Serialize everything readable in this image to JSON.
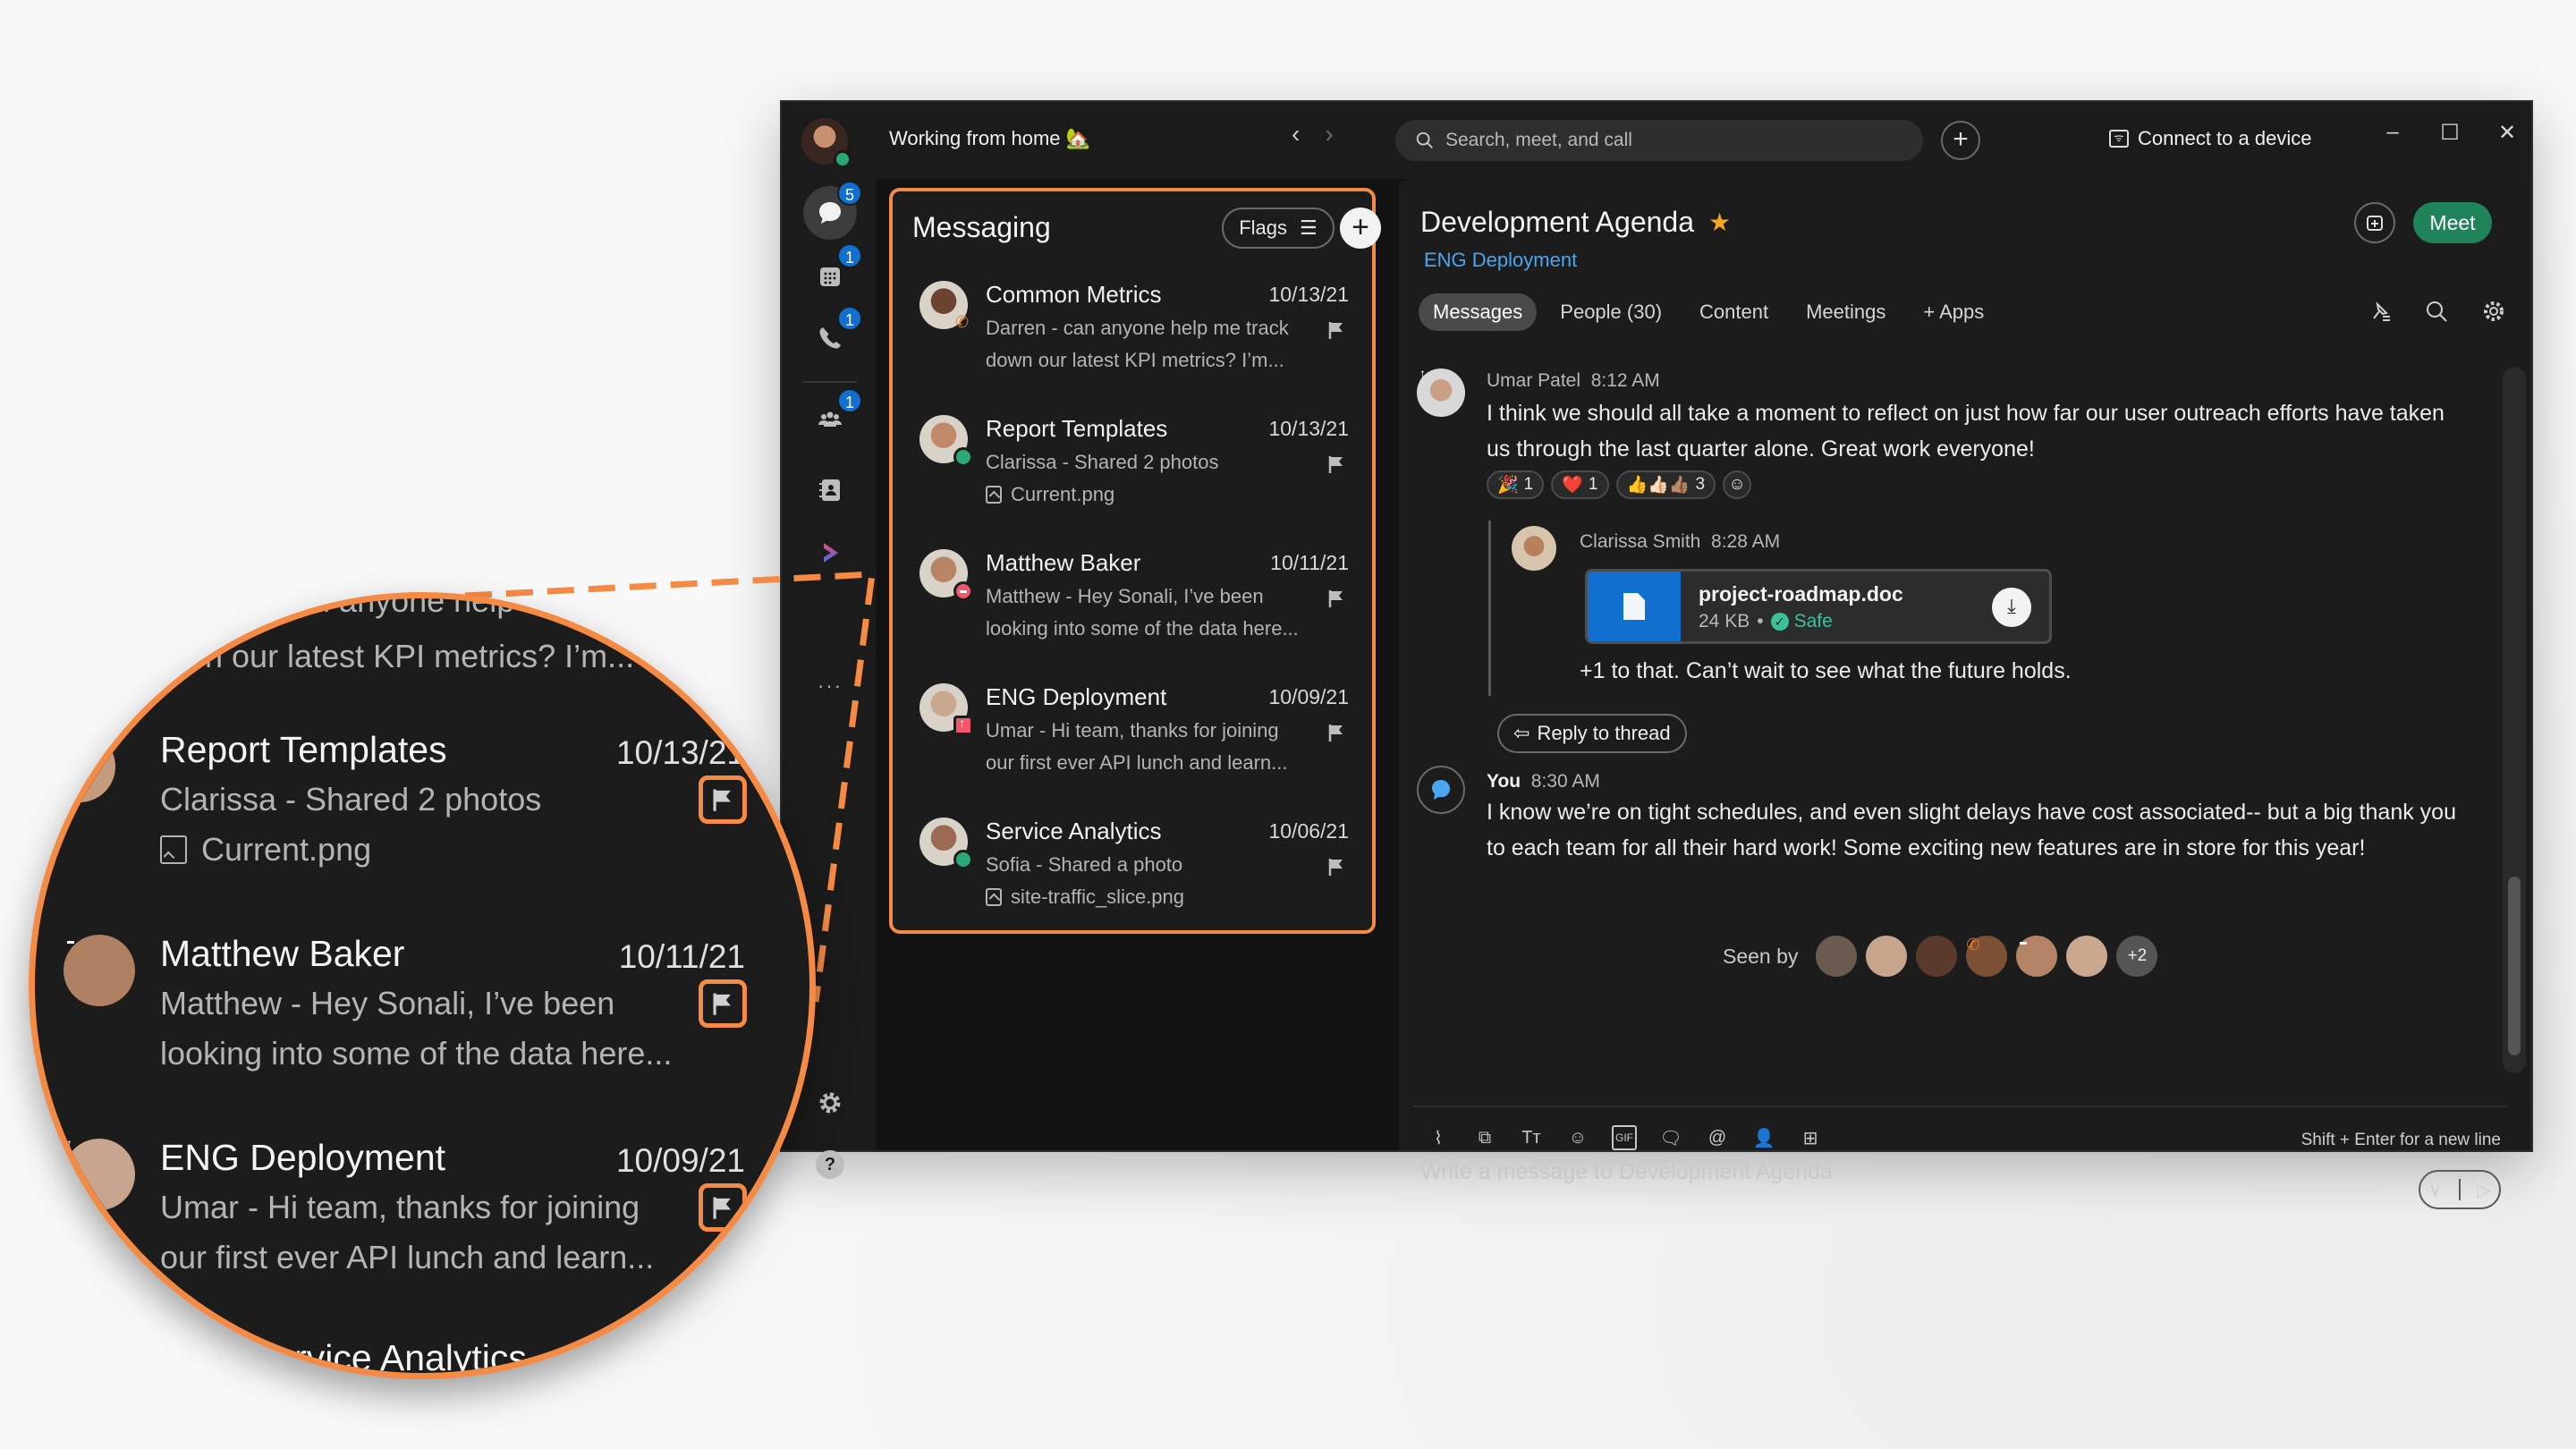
{
  "titlebar": {
    "status_text": "Working from home 🏡",
    "search_placeholder": "Search, meet, and call",
    "connect_label": "Connect to a device",
    "nav_back": "‹",
    "nav_forward": "›",
    "new_label": "+",
    "window_controls": {
      "minimize": "–",
      "maximize": "☐",
      "close": "✕"
    }
  },
  "rail": {
    "items": [
      {
        "name": "messaging",
        "badge": "5",
        "active": true
      },
      {
        "name": "calendar",
        "badge": "1"
      },
      {
        "name": "calling",
        "badge": "1"
      },
      {
        "name": "teams",
        "badge": "1"
      },
      {
        "name": "contacts",
        "badge": ""
      },
      {
        "name": "webex-app",
        "badge": ""
      }
    ],
    "more_label": "···",
    "help_label": "?"
  },
  "list": {
    "title": "Messaging",
    "filter_label": "Flags",
    "add_label": "+",
    "conversations": [
      {
        "name": "Common Metrics",
        "date": "10/13/21",
        "preview1": "Darren - can anyone help me track",
        "preview2": "down our latest KPI metrics? I’m...",
        "attachment": false,
        "status": "call",
        "flagged": true
      },
      {
        "name": "Report Templates",
        "date": "10/13/21",
        "preview1": "Clarissa - Shared 2 photos",
        "preview2": "Current.png",
        "attachment": true,
        "status": "available",
        "flagged": true
      },
      {
        "name": "Matthew Baker",
        "date": "10/11/21",
        "preview1": "Matthew - Hey Sonali, I’ve been",
        "preview2": "looking into some of the data here...",
        "attachment": false,
        "status": "dnd",
        "flagged": true
      },
      {
        "name": "ENG Deployment",
        "date": "10/09/21",
        "preview1": "Umar - Hi team, thanks for joining",
        "preview2": "our first ever API lunch and learn...",
        "attachment": false,
        "status": "out-of-office",
        "flagged": true
      },
      {
        "name": "Service Analytics",
        "date": "10/06/21",
        "preview1": "Sofia - Shared a photo",
        "preview2": "site-traffic_slice.png",
        "attachment": true,
        "status": "available",
        "flagged": true
      }
    ]
  },
  "space": {
    "title": "Development Agenda",
    "team": "ENG Deployment",
    "meet_label": "Meet",
    "tabs": [
      "Messages",
      "People (30)",
      "Content",
      "Meetings",
      "+  Apps"
    ],
    "active_tab": "Messages"
  },
  "messages": [
    {
      "author": "Umar Patel",
      "time": "8:12 AM",
      "text": "I think we should all take a moment to reflect on just how far our user outreach efforts have taken us through the last quarter alone. Great work everyone!",
      "reactions": [
        {
          "emoji": "🎉",
          "count": "1"
        },
        {
          "emoji": "❤️",
          "count": "1"
        },
        {
          "emoji": "👍👍🏻👍🏽",
          "count": "3"
        }
      ]
    },
    {
      "author": "Clarissa Smith",
      "time": "8:28 AM",
      "thread_reply": true,
      "file": {
        "name": "project-roadmap.doc",
        "size": "24 KB",
        "scan": "Safe"
      },
      "text": "+1 to that. Can’t wait to see what the future holds."
    },
    {
      "author": "You",
      "time": "8:30 AM",
      "text": "I know we’re on tight schedules, and even slight delays have cost associated-- but a big thank you to each team for all their hard work! Some exciting new features are in store for this year!"
    }
  ],
  "reply_label": "Reply to thread",
  "seen": {
    "label": "Seen by",
    "more": "+2"
  },
  "composer": {
    "placeholder": "Write a message to Development Agenda",
    "hint": "Shift + Enter for a new line"
  },
  "magnifier": {
    "top_fragment1": "an anyone help",
    "top_fragment2": "n our latest KPI metrics? I’m...",
    "bottom_fragment": "Service Analytics"
  },
  "colors": {
    "highlight": "#f58a45",
    "accent_blue": "#1170cf",
    "meet_green": "#1f845a",
    "available": "#2aa876",
    "dnd": "#f2566a",
    "star": "#f5a623"
  }
}
